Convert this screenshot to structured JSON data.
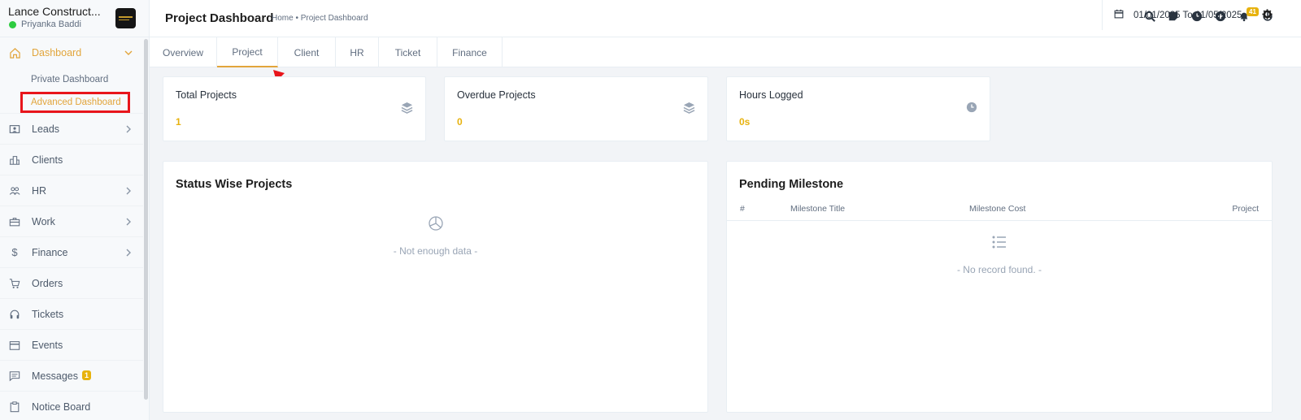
{
  "brand": {
    "company": "Lance Construct...",
    "user": "Priyanka Baddi"
  },
  "sidebar": {
    "dashboard": {
      "label": "Dashboard",
      "sub": [
        "Private Dashboard",
        "Advanced Dashboard"
      ]
    },
    "items": [
      {
        "label": "Leads",
        "icon": "contact-card-icon",
        "chevron": true
      },
      {
        "label": "Clients",
        "icon": "building-icon",
        "chevron": false
      },
      {
        "label": "HR",
        "icon": "people-icon",
        "chevron": true
      },
      {
        "label": "Work",
        "icon": "briefcase-icon",
        "chevron": true
      },
      {
        "label": "Finance",
        "icon": "dollar-icon",
        "chevron": true
      },
      {
        "label": "Orders",
        "icon": "cart-icon",
        "chevron": false
      },
      {
        "label": "Tickets",
        "icon": "headset-icon",
        "chevron": false
      },
      {
        "label": "Events",
        "icon": "calendar-icon",
        "chevron": false
      },
      {
        "label": "Messages",
        "icon": "chat-icon",
        "chevron": false
      },
      {
        "label": "Notice Board",
        "icon": "clipboard-icon",
        "chevron": false
      }
    ],
    "messages_badge": "1"
  },
  "header": {
    "title": "Project Dashboard",
    "breadcrumb": "Home • Project Dashboard",
    "notification_count": "41"
  },
  "tabs": [
    "Overview",
    "Project",
    "Client",
    "HR",
    "Ticket",
    "Finance"
  ],
  "active_tab": "Project",
  "date_range": "01/01/2025 To 01/05/2025",
  "stats": [
    {
      "title": "Total Projects",
      "value": "1",
      "icon": "layers-icon"
    },
    {
      "title": "Overdue Projects",
      "value": "0",
      "icon": "layers-icon"
    },
    {
      "title": "Hours Logged",
      "value": "0s",
      "icon": "clock-icon"
    }
  ],
  "status_panel": {
    "title": "Status Wise Projects",
    "empty": "- Not enough data -"
  },
  "milestone_panel": {
    "title": "Pending Milestone",
    "columns": [
      "#",
      "Milestone Title",
      "Milestone Cost",
      "Project"
    ],
    "empty": "- No record found. -"
  },
  "colors": {
    "accent": "#e2a53b",
    "highlight": "#e8151b",
    "badge": "#e7b20e"
  }
}
